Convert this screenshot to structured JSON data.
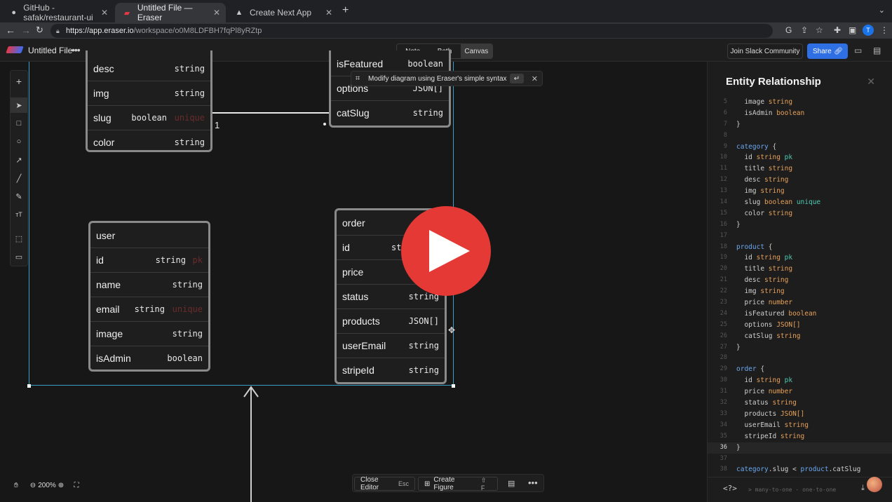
{
  "browser": {
    "tabs": [
      {
        "label": "GitHub - safak/restaurant-ui",
        "icon": "github-icon"
      },
      {
        "label": "Untitled File — Eraser",
        "icon": "eraser-icon"
      },
      {
        "label": "Create Next App",
        "icon": "triangle-icon"
      }
    ],
    "url_host": "https://app.eraser.io",
    "url_path": "/workspace/o0M8LDFBH7fqPl8yRZtp",
    "profile_initial": "T"
  },
  "app": {
    "file_name": "Untitled File",
    "view_modes": [
      "Note",
      "Both",
      "Canvas"
    ],
    "active_view": "Canvas",
    "slack_label": "Join Slack Community",
    "share_label": "Share"
  },
  "tooltip": {
    "text": "Modify diagram using Eraser's simple syntax"
  },
  "entities": {
    "category": {
      "rows": [
        {
          "name": "desc",
          "type": "string",
          "con": ""
        },
        {
          "name": "img",
          "type": "string",
          "con": ""
        },
        {
          "name": "slug",
          "type": "boolean",
          "con": "unique"
        },
        {
          "name": "color",
          "type": "string",
          "con": ""
        }
      ]
    },
    "product": {
      "rows": [
        {
          "name": "isFeatured",
          "type": "boolean"
        },
        {
          "name": "options",
          "type": "JSON[]"
        },
        {
          "name": "catSlug",
          "type": "string"
        }
      ]
    },
    "user": {
      "rows": [
        {
          "name": "user",
          "type": "",
          "con": ""
        },
        {
          "name": "id",
          "type": "string",
          "con": "pk"
        },
        {
          "name": "name",
          "type": "string",
          "con": ""
        },
        {
          "name": "email",
          "type": "string",
          "con": "unique"
        },
        {
          "name": "image",
          "type": "string",
          "con": ""
        },
        {
          "name": "isAdmin",
          "type": "boolean",
          "con": ""
        }
      ]
    },
    "order": {
      "rows": [
        {
          "name": "order",
          "type": ""
        },
        {
          "name": "id",
          "type": "st"
        },
        {
          "name": "price",
          "type": ""
        },
        {
          "name": "status",
          "type": "string"
        },
        {
          "name": "products",
          "type": "JSON[]"
        },
        {
          "name": "userEmail",
          "type": "string"
        },
        {
          "name": "stripeId",
          "type": "string"
        }
      ]
    },
    "relation_label": "1"
  },
  "bottom_toolbar": {
    "close_editor": "Close Editor",
    "close_key": "Esc",
    "create_figure": "Create Figure",
    "figure_key": "F",
    "zoom": "200%"
  },
  "panel": {
    "title": "Entity Relationship",
    "lines": [
      {
        "n": "5",
        "parts": [
          [
            "  image ",
            "p"
          ],
          [
            "string",
            "type"
          ]
        ]
      },
      {
        "n": "6",
        "parts": [
          [
            "  isAdmin ",
            "p"
          ],
          [
            "boolean",
            "type"
          ]
        ]
      },
      {
        "n": "7",
        "parts": [
          [
            "}",
            "p"
          ]
        ]
      },
      {
        "n": "8",
        "parts": []
      },
      {
        "n": "9",
        "parts": [
          [
            "category",
            "ent"
          ],
          [
            " {",
            "p"
          ]
        ]
      },
      {
        "n": "10",
        "parts": [
          [
            "  id ",
            "p"
          ],
          [
            "string",
            "type"
          ],
          [
            " ",
            "p"
          ],
          [
            "pk",
            "key"
          ]
        ]
      },
      {
        "n": "11",
        "parts": [
          [
            "  title ",
            "p"
          ],
          [
            "string",
            "type"
          ]
        ]
      },
      {
        "n": "12",
        "parts": [
          [
            "  desc ",
            "p"
          ],
          [
            "string",
            "type"
          ]
        ]
      },
      {
        "n": "13",
        "parts": [
          [
            "  img ",
            "p"
          ],
          [
            "string",
            "type"
          ]
        ]
      },
      {
        "n": "14",
        "parts": [
          [
            "  slug ",
            "p"
          ],
          [
            "boolean",
            "type"
          ],
          [
            " ",
            "p"
          ],
          [
            "unique",
            "key"
          ]
        ]
      },
      {
        "n": "15",
        "parts": [
          [
            "  color ",
            "p"
          ],
          [
            "string",
            "type"
          ]
        ]
      },
      {
        "n": "16",
        "parts": [
          [
            "}",
            "p"
          ]
        ]
      },
      {
        "n": "17",
        "parts": []
      },
      {
        "n": "18",
        "parts": [
          [
            "product",
            "ent"
          ],
          [
            " {",
            "p"
          ]
        ]
      },
      {
        "n": "19",
        "parts": [
          [
            "  id ",
            "p"
          ],
          [
            "string",
            "type"
          ],
          [
            " ",
            "p"
          ],
          [
            "pk",
            "key"
          ]
        ]
      },
      {
        "n": "20",
        "parts": [
          [
            "  title ",
            "p"
          ],
          [
            "string",
            "type"
          ]
        ]
      },
      {
        "n": "21",
        "parts": [
          [
            "  desc ",
            "p"
          ],
          [
            "string",
            "type"
          ]
        ]
      },
      {
        "n": "22",
        "parts": [
          [
            "  img ",
            "p"
          ],
          [
            "string",
            "type"
          ]
        ]
      },
      {
        "n": "23",
        "parts": [
          [
            "  price ",
            "p"
          ],
          [
            "number",
            "type"
          ]
        ]
      },
      {
        "n": "24",
        "parts": [
          [
            "  isFeatured ",
            "p"
          ],
          [
            "boolean",
            "type"
          ]
        ]
      },
      {
        "n": "25",
        "parts": [
          [
            "  options ",
            "p"
          ],
          [
            "JSON[]",
            "type"
          ]
        ]
      },
      {
        "n": "26",
        "parts": [
          [
            "  catSlug ",
            "p"
          ],
          [
            "string",
            "type"
          ]
        ]
      },
      {
        "n": "27",
        "parts": [
          [
            "}",
            "p"
          ]
        ]
      },
      {
        "n": "28",
        "parts": []
      },
      {
        "n": "29",
        "parts": [
          [
            "order",
            "ent"
          ],
          [
            " {",
            "p"
          ]
        ]
      },
      {
        "n": "30",
        "parts": [
          [
            "  id ",
            "p"
          ],
          [
            "string",
            "type"
          ],
          [
            " ",
            "p"
          ],
          [
            "pk",
            "key"
          ]
        ]
      },
      {
        "n": "31",
        "parts": [
          [
            "  price ",
            "p"
          ],
          [
            "number",
            "type"
          ]
        ]
      },
      {
        "n": "32",
        "parts": [
          [
            "  status ",
            "p"
          ],
          [
            "string",
            "type"
          ]
        ]
      },
      {
        "n": "33",
        "parts": [
          [
            "  products ",
            "p"
          ],
          [
            "JSON[]",
            "type"
          ]
        ]
      },
      {
        "n": "34",
        "parts": [
          [
            "  userEmail ",
            "p"
          ],
          [
            "string",
            "type"
          ]
        ]
      },
      {
        "n": "35",
        "parts": [
          [
            "  stripeId ",
            "p"
          ],
          [
            "string",
            "type"
          ]
        ]
      },
      {
        "n": "36",
        "parts": [
          [
            "}",
            "p"
          ]
        ],
        "current": true
      },
      {
        "n": "37",
        "parts": []
      },
      {
        "n": "38",
        "parts": [
          [
            "category",
            "ent"
          ],
          [
            ".slug < ",
            "p"
          ],
          [
            "product",
            "ent"
          ],
          [
            ".catSlug",
            "p"
          ]
        ]
      }
    ],
    "footer_icon": "<?>",
    "footer_hint": "> many-to-one  - one-to-one"
  }
}
